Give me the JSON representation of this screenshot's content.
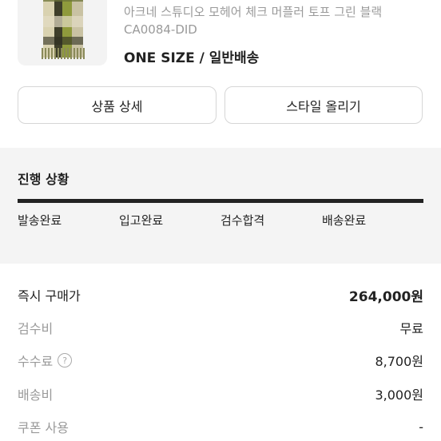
{
  "product": {
    "name": "아크네 스튜디오 모헤어 체크 머플러 토프 그린 블랙",
    "code": "CA0084-DID",
    "option": "ONE SIZE / 일반배송"
  },
  "buttons": {
    "detail": "상품 상세",
    "style_upload": "스타일 올리기"
  },
  "progress": {
    "title": "진행 상황",
    "steps": [
      "발송완료",
      "입고완료",
      "검수합격",
      "배송완료"
    ]
  },
  "price": {
    "rows": [
      {
        "label": "즉시 구매가",
        "value": "264,000원"
      },
      {
        "label": "검수비",
        "value": "무료"
      },
      {
        "label": "수수료",
        "value": "8,700원",
        "help": "?"
      },
      {
        "label": "배송비",
        "value": "3,000원"
      },
      {
        "label": "쿠폰 사용",
        "value": "-"
      }
    ]
  },
  "colors": {
    "progress_bar": "#222222",
    "section_bg": "#f4f4f4",
    "muted_text": "#9a9a9a"
  }
}
